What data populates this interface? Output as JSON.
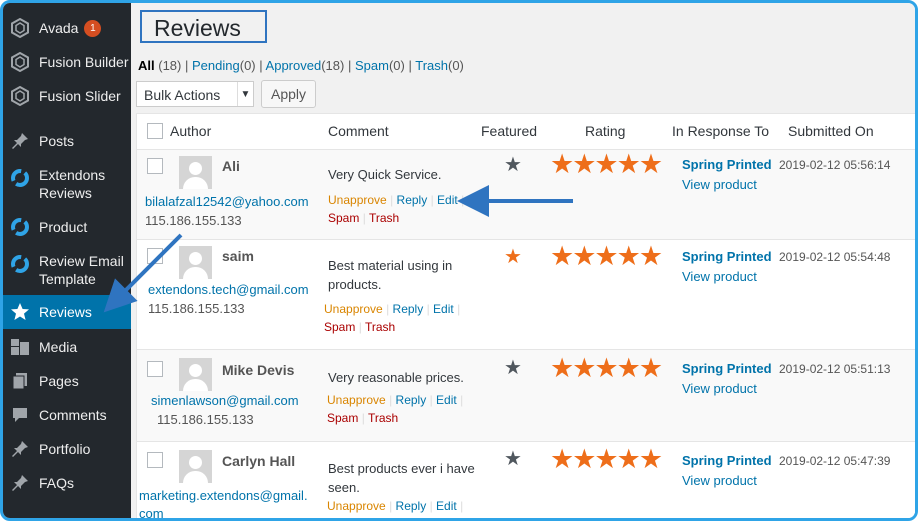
{
  "sidebar": {
    "items": [
      {
        "label": "Avada",
        "badge": "1",
        "icon": "avada-icon"
      },
      {
        "label": "Fusion Builder",
        "icon": "fusion-builder-icon"
      },
      {
        "label": "Fusion Slider",
        "icon": "fusion-slider-icon"
      },
      {
        "label": "Posts",
        "icon": "pin-icon"
      },
      {
        "label": "Extendons Reviews",
        "icon": "extendons-icon"
      },
      {
        "label": "Product",
        "icon": "extendons-icon"
      },
      {
        "label": "Review Email Template",
        "icon": "extendons-icon"
      },
      {
        "label": "Reviews",
        "icon": "star-icon"
      },
      {
        "label": "Media",
        "icon": "media-icon"
      },
      {
        "label": "Pages",
        "icon": "pages-icon"
      },
      {
        "label": "Comments",
        "icon": "comment-icon"
      },
      {
        "label": "Portfolio",
        "icon": "pin-icon"
      },
      {
        "label": "FAQs",
        "icon": "pin-icon"
      }
    ]
  },
  "page": {
    "title": "Reviews"
  },
  "filters": {
    "all": "All",
    "all_count": "(18)",
    "pending": "Pending",
    "pending_count": "(0)",
    "approved": "Approved",
    "approved_count": "(18)",
    "spam": "Spam",
    "spam_count": "(0)",
    "trash": "Trash",
    "trash_count": "(0)",
    "sep": "|"
  },
  "bulk": {
    "selected": "Bulk Actions",
    "apply_label": "Apply"
  },
  "table": {
    "columns": [
      "Author",
      "Comment",
      "Featured",
      "Rating",
      "In Response To",
      "Submitted On"
    ],
    "rows": [
      {
        "name": "Ali",
        "email": "bilalafzal12542@yahoo.com",
        "ip": "115.186.155.133",
        "comment": "Very Quick Service.",
        "featured": false,
        "rating": 5,
        "response_title": "Spring Printed",
        "response_link": "View product",
        "date": "2019-02-12 05:56:14"
      },
      {
        "name": "saim",
        "email": "extendons.tech@gmail.com",
        "ip": "115.186.155.133",
        "comment": "Best material using in products.",
        "featured": true,
        "rating": 5,
        "response_title": "Spring Printed",
        "response_link": "View product",
        "date": "2019-02-12 05:54:48"
      },
      {
        "name": "Mike Devis",
        "email": "simenlawson@gmail.com",
        "ip": "115.186.155.133",
        "comment": "Very reasonable prices.",
        "featured": false,
        "rating": 5,
        "response_title": "Spring Printed",
        "response_link": "View product",
        "date": "2019-02-12 05:51:13"
      },
      {
        "name": "Carlyn Hall",
        "email": "marketing.extendons@gmail.com",
        "ip": "",
        "comment": "Best products ever i have seen.",
        "featured": false,
        "rating": 5,
        "response_title": "Spring Printed",
        "response_link": "View product",
        "date": "2019-02-12 05:47:39"
      }
    ],
    "actions": {
      "unapprove": "Unapprove",
      "reply": "Reply",
      "edit": "Edit",
      "spam": "Spam",
      "trash": "Trash",
      "sep": "|"
    }
  },
  "colors": {
    "accent": "#0073aa",
    "sidebar_bg": "#23282d",
    "star": "#ee6e1a",
    "featured_on": "#ee6e1a",
    "featured_off": "#50575e",
    "annotation_arrow": "#2f74c0",
    "frame_border": "#2fa4e7"
  }
}
